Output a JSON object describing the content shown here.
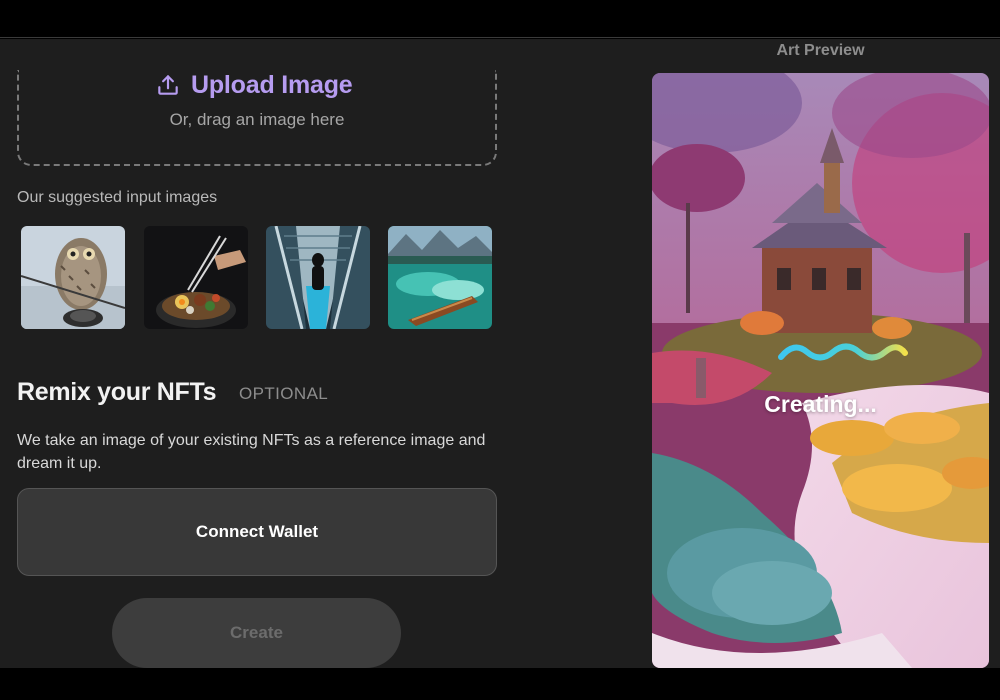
{
  "upload": {
    "label": "Upload Image",
    "hint": "Or, drag an image here",
    "icon": "upload-icon"
  },
  "suggested": {
    "title": "Our suggested input images",
    "images": [
      "owl",
      "food with chopsticks",
      "person on escalator",
      "boat on lake"
    ]
  },
  "remix": {
    "title": "Remix your NFTs",
    "optional_label": "OPTIONAL",
    "description": "We take an image of your existing NFTs as a reference image and dream it up."
  },
  "buttons": {
    "connect_wallet": "Connect Wallet",
    "create": "Create"
  },
  "preview": {
    "title": "Art Preview",
    "status": "Creating...",
    "loading_icon": "wave-loader-icon"
  },
  "colors": {
    "accent": "#b69cf0",
    "background": "#1e1e1e",
    "wave_start": "#3ec7f0",
    "wave_end": "#f3e04a"
  }
}
